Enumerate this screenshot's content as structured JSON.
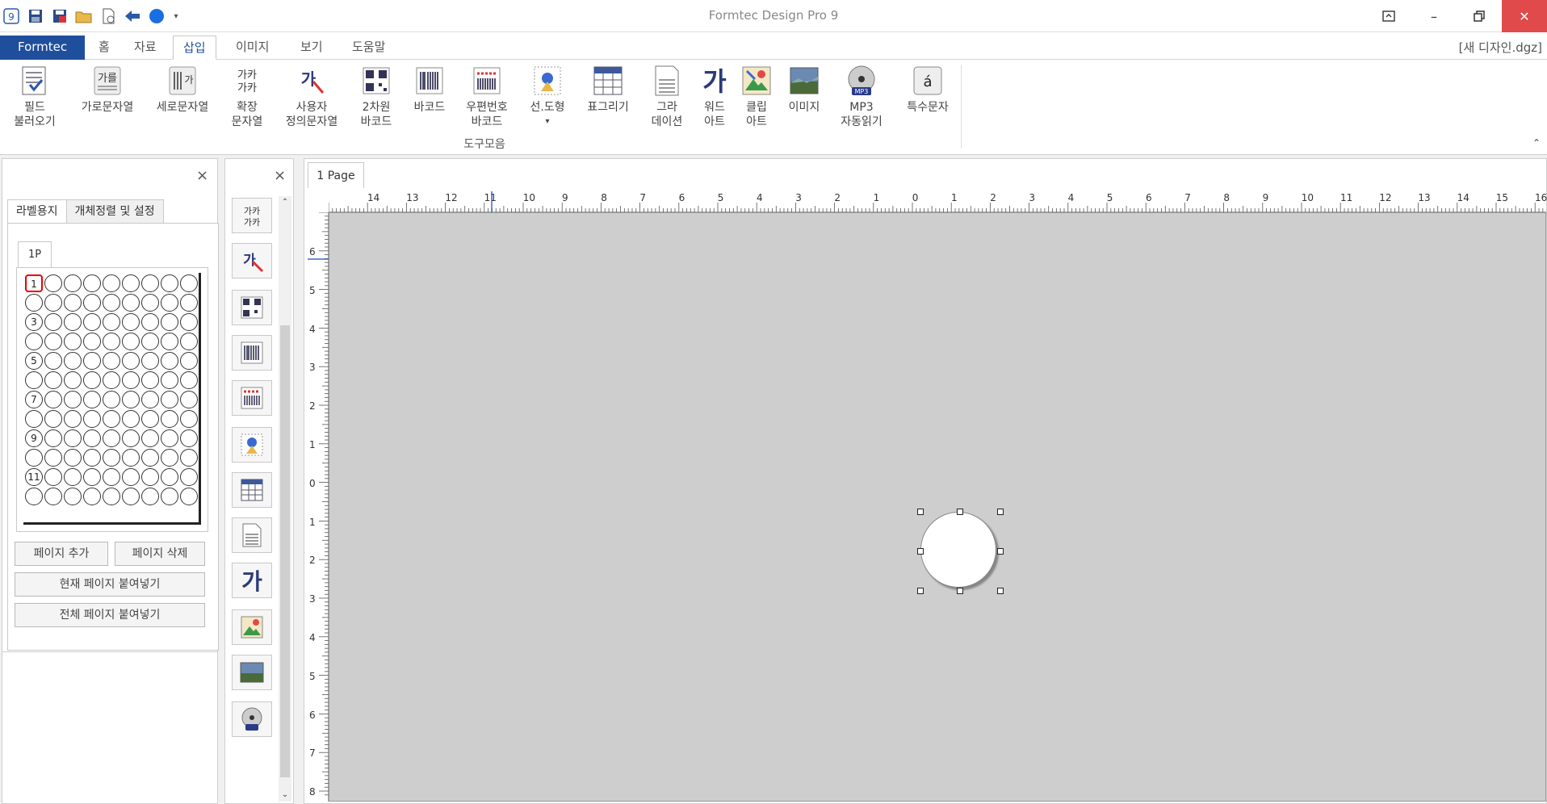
{
  "app": {
    "title": "Formtec Design Pro 9",
    "document": "[새 디자인.dgz]"
  },
  "quick_access": [
    "app-logo-icon",
    "save-icon",
    "save-as-icon",
    "open-folder-icon",
    "new-document-icon",
    "back-arrow-icon",
    "circle-tool-icon",
    "dropdown-chevron-icon"
  ],
  "menu_tabs": [
    {
      "label": "Formtec"
    },
    {
      "label": "홈"
    },
    {
      "label": "자료"
    },
    {
      "label": "삽입"
    },
    {
      "label": "이미지"
    },
    {
      "label": "보기"
    },
    {
      "label": "도움말"
    }
  ],
  "ribbon": {
    "group_label": "도구모음",
    "buttons": [
      {
        "line1": "필드",
        "line2": "불러오기"
      },
      {
        "line1": "가로문자열",
        "line2": ""
      },
      {
        "line1": "세로문자열",
        "line2": ""
      },
      {
        "line1": "확장",
        "line2": "문자열"
      },
      {
        "line1": "사용자",
        "line2": "정의문자열"
      },
      {
        "line1": "2차원",
        "line2": "바코드"
      },
      {
        "line1": "바코드",
        "line2": ""
      },
      {
        "line1": "우편번호",
        "line2": "바코드"
      },
      {
        "line1": "선.도형",
        "line2": "▾"
      },
      {
        "line1": "표그리기",
        "line2": ""
      },
      {
        "line1": "그라",
        "line2": "데이션"
      },
      {
        "line1": "워드",
        "line2": "아트"
      },
      {
        "line1": "클립",
        "line2": "아트"
      },
      {
        "line1": "이미지",
        "line2": ""
      },
      {
        "line1": "MP3",
        "line2": "자동읽기"
      },
      {
        "line1": "특수문자",
        "line2": ""
      }
    ]
  },
  "left_panel": {
    "tabs": [
      "라벨용지",
      "개체정렬 및 설정"
    ],
    "page_tab": "1P",
    "row_numbers": [
      "1",
      "3",
      "5",
      "7",
      "9",
      "11"
    ],
    "buttons": {
      "add_page": "페이지 추가",
      "delete_page": "페이지 삭제",
      "paste_current": "현재 페이지 붙여넣기",
      "paste_all": "전체 페이지 붙여넣기"
    }
  },
  "work": {
    "page_tab": "1 Page",
    "h_ruler_labels": [
      "14",
      "13",
      "12",
      "11",
      "10",
      "9",
      "8",
      "7",
      "6",
      "5",
      "4",
      "3",
      "2",
      "1",
      "0",
      "1",
      "2",
      "3",
      "4",
      "5",
      "6",
      "7",
      "8",
      "9",
      "10",
      "11",
      "12",
      "13",
      "14",
      "15",
      "16"
    ],
    "v_ruler_labels": [
      "6",
      "5",
      "4",
      "3",
      "2",
      "1",
      "0",
      "1",
      "2",
      "3",
      "4",
      "5",
      "6",
      "7",
      "8"
    ]
  },
  "colors": {
    "file_tab": "#1f4f9c",
    "close_button": "#e04a4a",
    "canvas": "#cecece"
  }
}
